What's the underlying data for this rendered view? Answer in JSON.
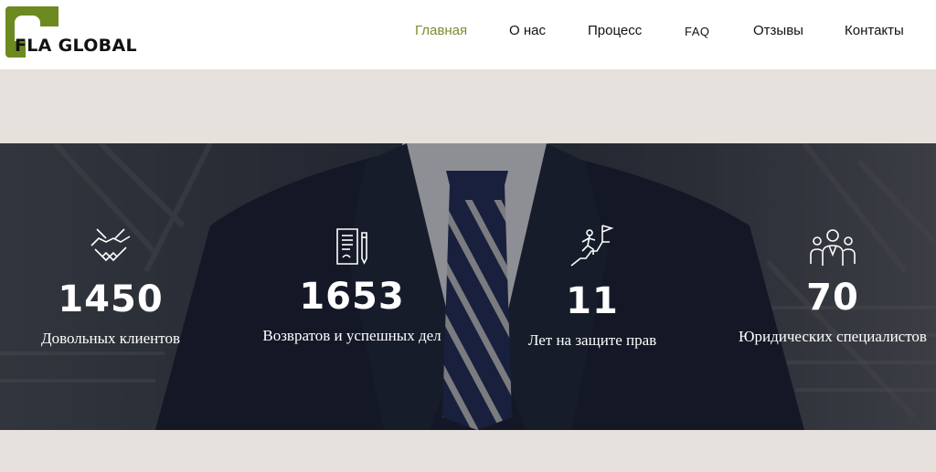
{
  "header": {
    "logo_text": "FLA GLOBAL",
    "nav": [
      {
        "label": "Главная",
        "active": true
      },
      {
        "label": "О нас"
      },
      {
        "label": "Процесс"
      },
      {
        "label": "FAQ"
      },
      {
        "label": "Отзывы"
      },
      {
        "label": "Контакты"
      }
    ]
  },
  "colors": {
    "accent": "#7d8a2e",
    "logo_green": "#6c8a1f",
    "page_bg": "#e6e1dc"
  },
  "stats": [
    {
      "icon": "handshake-icon",
      "value": "1450",
      "label": "Довольных клиентов"
    },
    {
      "icon": "document-pen-icon",
      "value": "1653",
      "label": "Возвратов и успешных дел"
    },
    {
      "icon": "climb-flag-icon",
      "value": "11",
      "label": "Лет на защите прав"
    },
    {
      "icon": "team-people-icon",
      "value": "70",
      "label": "Юридических специалистов"
    }
  ]
}
